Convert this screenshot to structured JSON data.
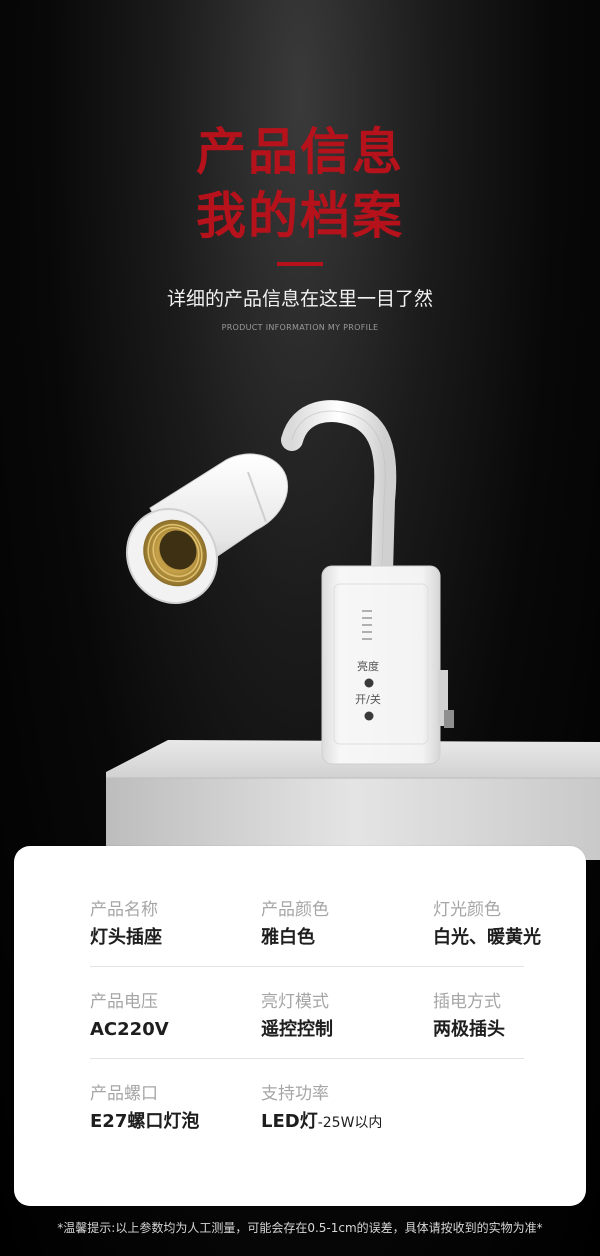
{
  "header": {
    "title_line1": "产品信息",
    "title_line2": "我的档案",
    "subtitle": "详细的产品信息在这里一目了然",
    "caption_en": "PRODUCT INFORMATION MY PROFILE"
  },
  "product": {
    "button_labels": {
      "brightness": "亮度",
      "power": "开/关"
    },
    "colors": {
      "accent_red": "#b5121b",
      "body_white": "#f4f4f4",
      "socket_gold": "#c8a24a"
    }
  },
  "specs": {
    "rows": [
      [
        {
          "label": "产品名称",
          "value": "灯头插座"
        },
        {
          "label": "产品颜色",
          "value": "雅白色"
        },
        {
          "label": "灯光颜色",
          "value": "白光、暖黄光"
        }
      ],
      [
        {
          "label": "产品电压",
          "value": "AC220V"
        },
        {
          "label": "亮灯模式",
          "value": "遥控控制"
        },
        {
          "label": "插电方式",
          "value": "两极插头"
        }
      ],
      [
        {
          "label": "产品螺口",
          "value": "E27螺口灯泡"
        },
        {
          "label": "支持功率",
          "value": "LED灯",
          "value_suffix": "-25W以内"
        }
      ]
    ]
  },
  "footnote": "*温馨提示:以上参数均为人工测量，可能会存在0.5-1cm的误差，具体请按收到的实物为准*"
}
